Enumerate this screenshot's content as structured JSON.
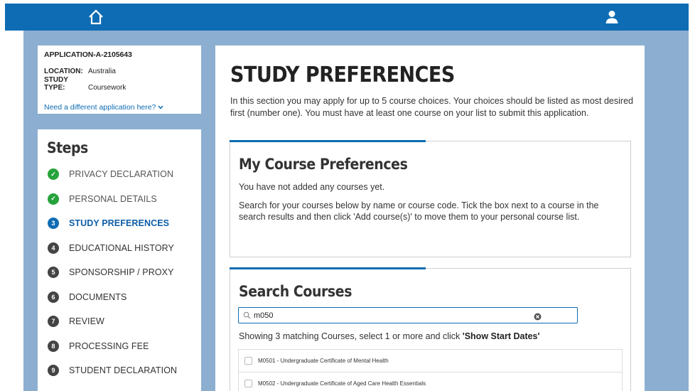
{
  "header": {
    "home_icon": "home-icon",
    "user_icon": "user-icon",
    "bar_color": "#0d6cb3"
  },
  "application": {
    "id": "APPLICATION-A-2105643",
    "location_label": "LOCATION:",
    "location_value": "Australia",
    "study_type_label": "STUDY TYPE:",
    "study_type_value": "Coursework",
    "change_link": "Need a different application here?",
    "change_icon": "chevron-down-icon"
  },
  "steps": {
    "title": "Steps",
    "items": [
      {
        "marker": "✓",
        "label": "PRIVACY DECLARATION",
        "state": "done"
      },
      {
        "marker": "✓",
        "label": "PERSONAL DETAILS",
        "state": "done"
      },
      {
        "marker": "3",
        "label": "STUDY PREFERENCES",
        "state": "current"
      },
      {
        "marker": "4",
        "label": "EDUCATIONAL HISTORY",
        "state": "todo"
      },
      {
        "marker": "5",
        "label": "SPONSORSHIP / PROXY",
        "state": "todo"
      },
      {
        "marker": "6",
        "label": "DOCUMENTS",
        "state": "todo"
      },
      {
        "marker": "7",
        "label": "REVIEW",
        "state": "todo"
      },
      {
        "marker": "8",
        "label": "PROCESSING FEE",
        "state": "todo"
      },
      {
        "marker": "9",
        "label": "STUDENT DECLARATION",
        "state": "todo"
      }
    ]
  },
  "main": {
    "title": "STUDY PREFERENCES",
    "intro": "In this section you may apply for up to 5 course choices. Your choices should be listed as most desired first (number one). You must have at least one course on your list to submit this application.",
    "preferences": {
      "title": "My Course Preferences",
      "empty_text": "You have not added any courses yet.",
      "help_text": "Search for your courses below by name or course code. Tick the box next to a course in the search results and then click 'Add course(s)' to move them to your personal course list."
    },
    "search": {
      "title": "Search Courses",
      "query": "m050",
      "placeholder": "",
      "match_prefix": "Showing 3 matching Courses, select 1 or more and click ",
      "match_action": "'Show Start Dates'",
      "results": [
        {
          "label": "M0501 - Undergraduate Certificate of Mental Health"
        },
        {
          "label": "M0502 - Undergraduate Certificate of Aged Care Health Essentials"
        }
      ]
    }
  }
}
